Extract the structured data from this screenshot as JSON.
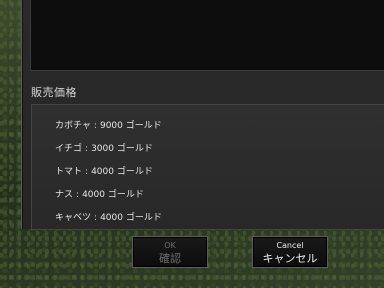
{
  "dialog": {
    "section_label": "販売価格",
    "items": [
      {
        "name": "カボチャ",
        "price": "9000",
        "unit": "ゴールド"
      },
      {
        "name": "イチゴ",
        "price": "3000",
        "unit": "ゴールド"
      },
      {
        "name": "トマト",
        "price": "4000",
        "unit": "ゴールド"
      },
      {
        "name": "ナス",
        "price": "4000",
        "unit": "ゴールド"
      },
      {
        "name": "キャベツ",
        "price": "4000",
        "unit": "ゴールド"
      }
    ],
    "separator": ":",
    "ok_button": {
      "label_en": "OK",
      "label_jp": "確認",
      "enabled": false
    },
    "cancel_button": {
      "label_en": "Cancel",
      "label_jp": "キャンセル",
      "enabled": true
    }
  }
}
